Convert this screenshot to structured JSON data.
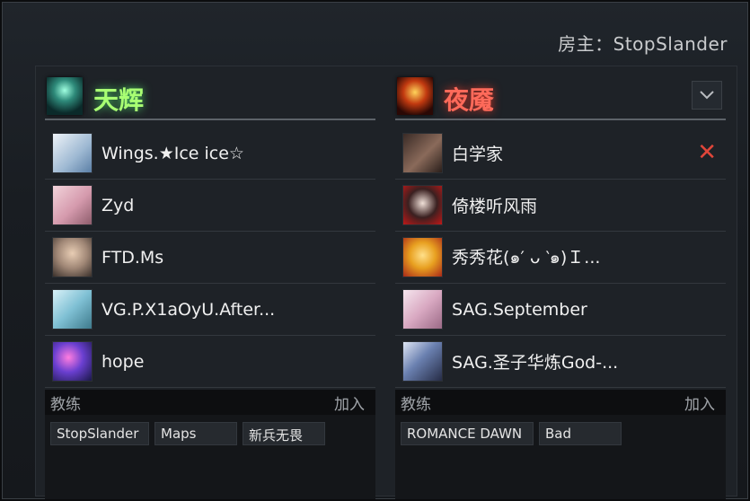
{
  "host": {
    "text": "房主：StopSlander"
  },
  "radiant": {
    "name": "天辉",
    "players": [
      {
        "name": "Wings.★Ice ice☆",
        "avatar_color": "#c9d8e8"
      },
      {
        "name": "Zyd",
        "avatar_color": "#d9a7b6"
      },
      {
        "name": "FTD.Ms",
        "avatar_color": "#b7b0a8"
      },
      {
        "name": "VG.P.X1aOyU.After...",
        "avatar_color": "#8fc7d8"
      },
      {
        "name": "hope",
        "avatar_color": "#7a3fb8"
      }
    ],
    "coach_label": "教练",
    "join_label": "加入",
    "spectators": [
      "StopSlander",
      "Maps",
      "新兵无畏"
    ]
  },
  "dire": {
    "name": "夜魇",
    "players": [
      {
        "name": "白学家",
        "avatar_color": "#6b4a3c"
      },
      {
        "name": "倚楼听风雨",
        "avatar_color": "#2a1a1a"
      },
      {
        "name": "秀秀花(๑′ ᴗ ‵๑)Ｉ...",
        "avatar_color": "#e8b23a"
      },
      {
        "name": "SAG.September",
        "avatar_color": "#d8a8c0"
      },
      {
        "name": "SAG.圣子华炼God-...",
        "avatar_color": "#4a5f8a"
      }
    ],
    "coach_label": "教练",
    "join_label": "加入",
    "spectators": [
      "ROMANCE DAWN",
      "Bad"
    ]
  },
  "colors": {
    "radiant": "#a9ff73",
    "dire": "#ff6a5a",
    "kick": "#e0463a"
  },
  "icons": {
    "collapse": "chevron-down-icon",
    "kick": "close-icon"
  }
}
